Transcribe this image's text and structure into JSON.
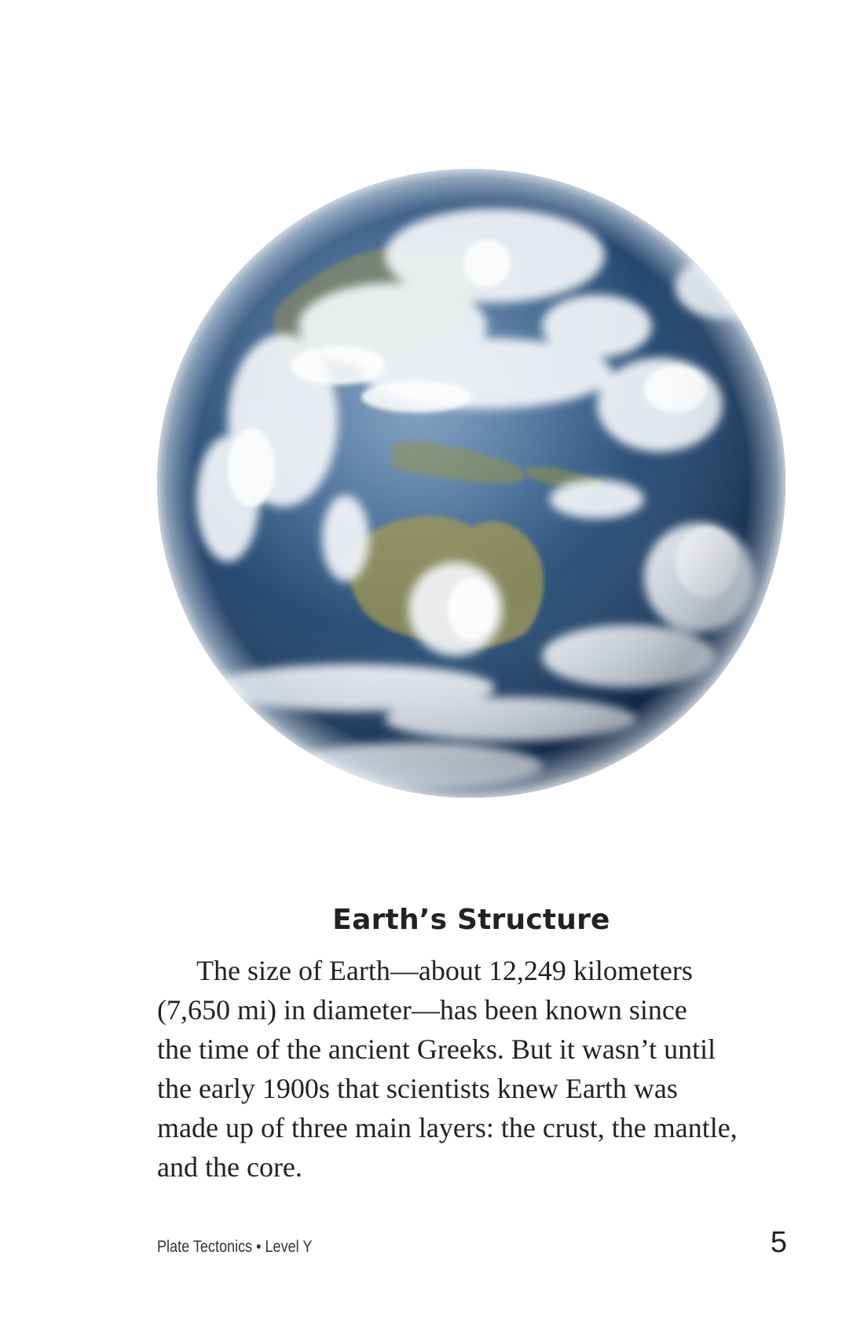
{
  "figure": {
    "icon": "earth-globe-photo"
  },
  "section": {
    "heading": "Earth’s Structure",
    "paragraph_lines": [
      "The size of Earth—about 12,249 kilometers",
      "(7,650 mi) in diameter—has been known since",
      "the time of the ancient Greeks. But it wasn’t until",
      "the early 1900s that scientists knew Earth was",
      "made up of three main layers: the crust, the mantle,",
      "and the core."
    ]
  },
  "footer": {
    "book_label": "Plate Tectonics • Level Y",
    "page_number": "5"
  }
}
